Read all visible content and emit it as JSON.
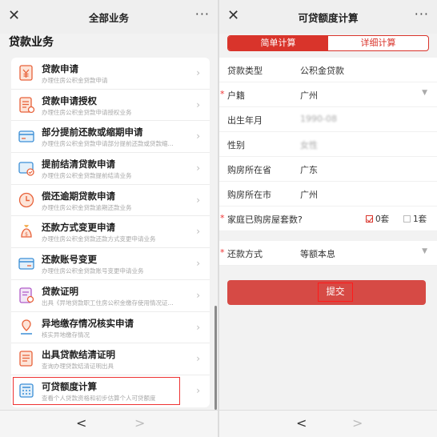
{
  "left": {
    "header": {
      "close": "✕",
      "title": "全部业务",
      "more": "···"
    },
    "section_title": "贷款业务",
    "items": [
      {
        "name": "贷款申请",
        "desc": "办理住房公积金贷款申请",
        "icon": "yen-doc-icon"
      },
      {
        "name": "贷款申请授权",
        "desc": "办理住房公积金贷款申请授权业务",
        "icon": "doc-authorize-icon"
      },
      {
        "name": "部分提前还款或缩期申请",
        "desc": "办理住房公积金贷款申请部分提前还款或贷款缩...",
        "icon": "card-icon"
      },
      {
        "name": "提前结清贷款申请",
        "desc": "办理住房公积金贷款提前结清业务",
        "icon": "card-settle-icon"
      },
      {
        "name": "偿还逾期贷款申请",
        "desc": "办理住房公积金贷款逾期还款业务",
        "icon": "clock-icon"
      },
      {
        "name": "还款方式变更申请",
        "desc": "办理住房公积金贷款还款方式变更申请业务",
        "icon": "moneybag-icon"
      },
      {
        "name": "还款账号变更",
        "desc": "办理住房公积金贷款账号变更申请业务",
        "icon": "account-card-icon"
      },
      {
        "name": "贷款证明",
        "desc": "出具《异地贷款职工住房公积金缴存使用情况证...",
        "icon": "certificate-icon"
      },
      {
        "name": "异地缴存情况核实申请",
        "desc": "核实异地缴存情况",
        "icon": "location-verify-icon"
      },
      {
        "name": "出具贷款结清证明",
        "desc": "查询办理贷款结清证明出具",
        "icon": "settle-cert-icon"
      },
      {
        "name": "可贷额度计算",
        "desc": "查看个人贷款资格和初步估算个人可贷额度",
        "icon": "calculator-icon"
      }
    ],
    "bottom": {
      "back": "<",
      "forward": ">"
    }
  },
  "right": {
    "header": {
      "close": "✕",
      "title": "可贷额度计算",
      "more": "···"
    },
    "tabs": {
      "simple": "简单计算",
      "detail": "详细计算"
    },
    "fields": [
      {
        "label": "贷款类型",
        "value": "公积金贷款",
        "required": false
      },
      {
        "label": "户籍",
        "value": "广州",
        "required": true,
        "dropdown": true
      },
      {
        "label": "出生年月",
        "value": "1990-08",
        "required": false,
        "blur": true
      },
      {
        "label": "性别",
        "value": "女性",
        "required": false,
        "blur": true
      },
      {
        "label": "购房所在省",
        "value": "广东",
        "required": false
      },
      {
        "label": "购房所在市",
        "value": "广州",
        "required": false
      }
    ],
    "houses": {
      "label": "家庭已购房屋套数?",
      "opt0": "0套",
      "opt1": "1套",
      "selected": "0套"
    },
    "repay": {
      "label": "还款方式",
      "value": "等额本息"
    },
    "submit": "提交",
    "star": "*",
    "caret": "▼",
    "bottom": {
      "back": "<",
      "forward": ">"
    }
  },
  "colors": {
    "accent": "#d9342b",
    "highlight": "#ff1a1a",
    "icon": "#e8623a"
  }
}
